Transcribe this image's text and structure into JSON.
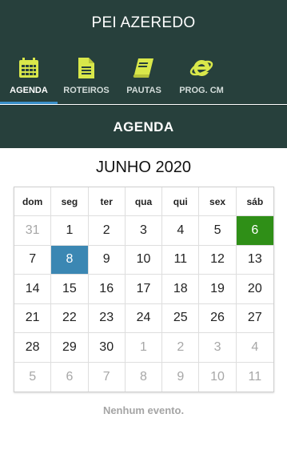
{
  "app_title": "PEI AZEREDO",
  "tabs": [
    {
      "label": "AGENDA",
      "icon": "calendar-icon"
    },
    {
      "label": "ROTEIROS",
      "icon": "document-icon"
    },
    {
      "label": "PAUTAS",
      "icon": "book-icon"
    },
    {
      "label": "PROG. CM",
      "icon": "browser-e-icon"
    }
  ],
  "active_tab": "AGENDA",
  "section_title": "AGENDA",
  "calendar": {
    "month_title": "JUNHO 2020",
    "weekdays": [
      "dom",
      "seg",
      "ter",
      "qua",
      "qui",
      "sex",
      "sáb"
    ],
    "weeks": [
      [
        "31",
        "1",
        "2",
        "3",
        "4",
        "5",
        "6"
      ],
      [
        "7",
        "8",
        "9",
        "10",
        "11",
        "12",
        "13"
      ],
      [
        "14",
        "15",
        "16",
        "17",
        "18",
        "19",
        "20"
      ],
      [
        "21",
        "22",
        "23",
        "24",
        "25",
        "26",
        "27"
      ],
      [
        "28",
        "29",
        "30",
        "1",
        "2",
        "3",
        "4"
      ],
      [
        "5",
        "6",
        "7",
        "8",
        "9",
        "10",
        "11"
      ]
    ],
    "highlight_today": "6",
    "highlight_selected": "8"
  },
  "empty_message": "Nenhum evento.",
  "colors": {
    "header_bg": "#27403c",
    "tab_icon": "#d9e84a",
    "today": "#2f8f17",
    "selected": "#3b87b3",
    "active_indicator": "#3a8fc9"
  }
}
